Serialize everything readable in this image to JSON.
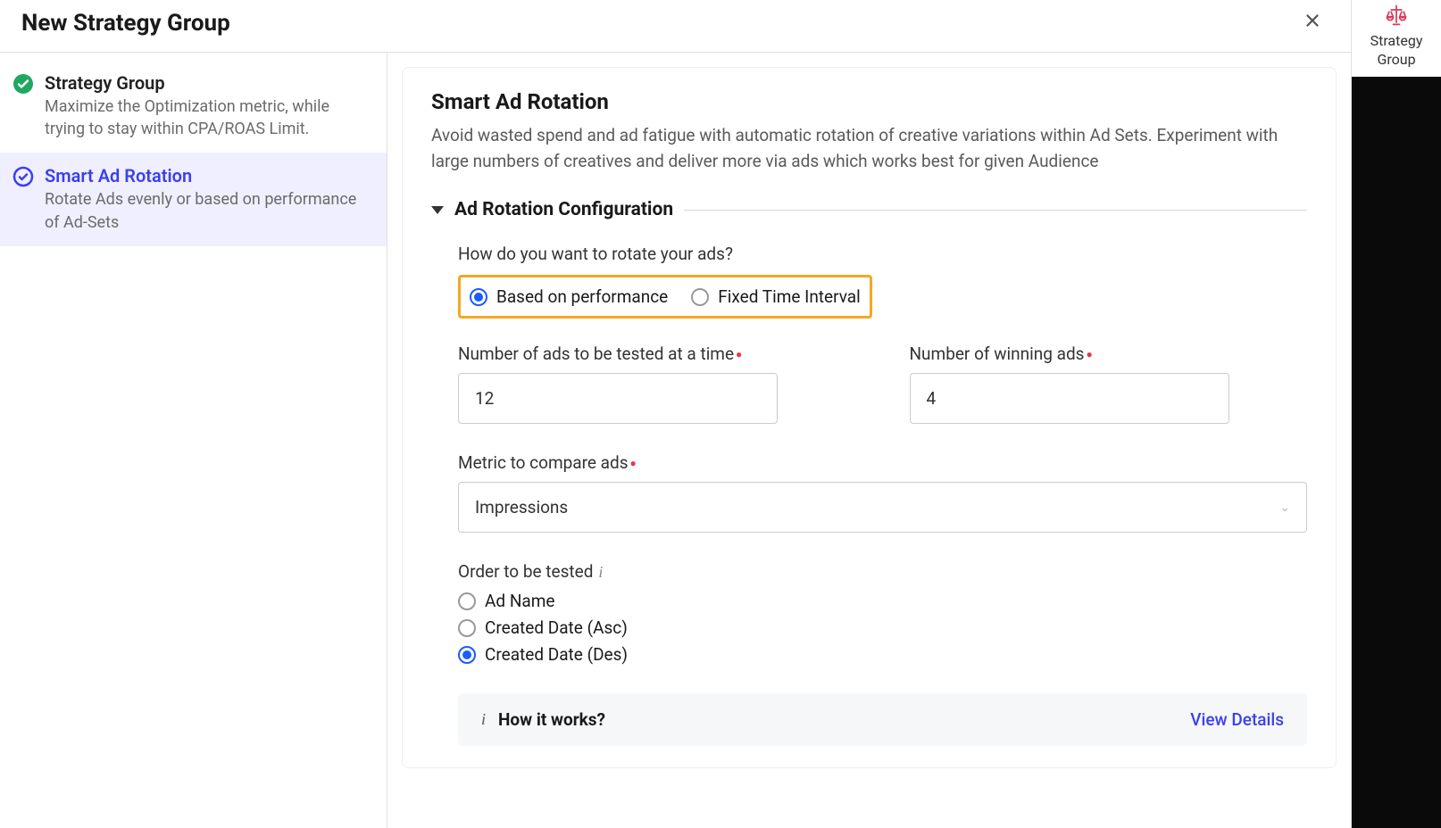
{
  "header": {
    "title": "New Strategy Group"
  },
  "sidebar": {
    "steps": [
      {
        "title": "Strategy Group",
        "desc": "Maximize the Optimization metric, while trying to stay within CPA/ROAS Limit."
      },
      {
        "title": "Smart Ad Rotation",
        "desc": "Rotate Ads evenly or based on performance of Ad-Sets"
      }
    ]
  },
  "main": {
    "title": "Smart Ad Rotation",
    "desc": "Avoid wasted spend and ad fatigue with automatic rotation of creative variations within Ad Sets. Experiment with large numbers of creatives and deliver more via ads which works best for given Audience",
    "config_title": "Ad Rotation Configuration",
    "rotate_q": "How do you want to rotate your ads?",
    "radio_perf": "Based on performance",
    "radio_fixed": "Fixed Time Interval",
    "num_ads_label": "Number of ads to be tested at a time",
    "num_ads_value": "12",
    "num_win_label": "Number of winning ads",
    "num_win_value": "4",
    "metric_label": "Metric to compare ads",
    "metric_value": "Impressions",
    "order_label": "Order to be tested",
    "order_opts": [
      "Ad Name",
      "Created Date (Asc)",
      "Created Date (Des)"
    ],
    "how_it_works": "How it works?",
    "view_details": "View Details"
  },
  "right": {
    "label": "Strategy Group"
  }
}
